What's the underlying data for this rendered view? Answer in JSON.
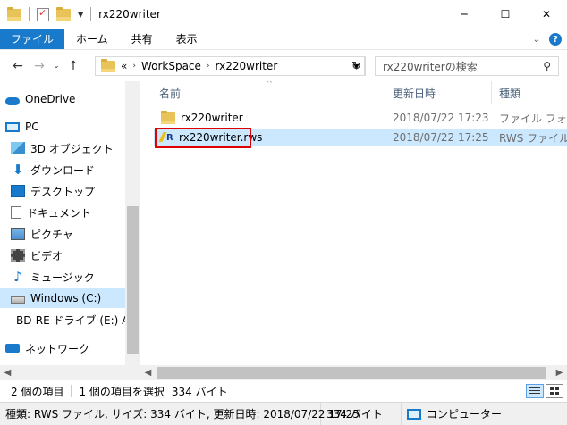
{
  "window": {
    "title": "rx220writer",
    "minimize": "─",
    "maximize": "☐",
    "close": "✕"
  },
  "ribbon": {
    "tabs": [
      "ファイル",
      "ホーム",
      "共有",
      "表示"
    ]
  },
  "address": {
    "overflow": "«",
    "crumbs": [
      "WorkSpace",
      "rx220writer"
    ],
    "search_placeholder": "rx220writerの検索"
  },
  "nav": {
    "items": [
      {
        "label": "OneDrive",
        "icon": "onedrive-icon"
      },
      {
        "label": "PC",
        "icon": "pc-icon"
      },
      {
        "label": "3D オブジェクト",
        "icon": "3d-objects-icon"
      },
      {
        "label": "ダウンロード",
        "icon": "download-icon"
      },
      {
        "label": "デスクトップ",
        "icon": "desktop-icon"
      },
      {
        "label": "ドキュメント",
        "icon": "documents-icon"
      },
      {
        "label": "ピクチャ",
        "icon": "pictures-icon"
      },
      {
        "label": "ビデオ",
        "icon": "videos-icon"
      },
      {
        "label": "ミュージック",
        "icon": "music-icon"
      },
      {
        "label": "Windows (C:)",
        "icon": "drive-icon"
      },
      {
        "label": "BD-RE ドライブ (E:) AE",
        "icon": "disc-drive-icon"
      },
      {
        "label": "ネットワーク",
        "icon": "network-icon"
      }
    ]
  },
  "columns": {
    "name": "名前",
    "modified": "更新日時",
    "type": "種類"
  },
  "files": [
    {
      "name": "rx220writer",
      "modified": "2018/07/22 17:23",
      "type": "ファイル フォルダー",
      "icon": "folder-icon"
    },
    {
      "name": "rx220writer.rws",
      "modified": "2018/07/22 17:25",
      "type": "RWS ファイル",
      "icon": "rws-file-icon"
    }
  ],
  "status": {
    "item_count": "2 個の項目",
    "selection": "1 個の項目を選択",
    "selection_size": "334 バイト"
  },
  "infobar": {
    "details": "種類: RWS ファイル, サイズ: 334 バイト, 更新日時: 2018/07/22 17:25",
    "size": "334 バイト",
    "location": "コンピューター"
  }
}
